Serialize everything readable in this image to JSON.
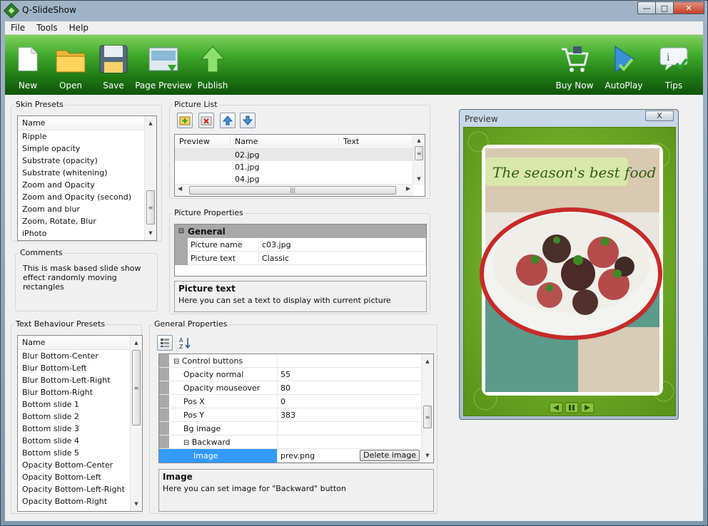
{
  "window": {
    "title": "Q-SlideShow"
  },
  "menu": [
    "File",
    "Tools",
    "Help"
  ],
  "toolbar": {
    "new": "New",
    "open": "Open",
    "save": "Save",
    "page_preview": "Page Preview",
    "publish": "Publish",
    "buy_now": "Buy Now",
    "autoplay": "AutoPlay",
    "tips": "Tips"
  },
  "skin_presets": {
    "title": "Skin Presets",
    "header": "Name",
    "items": [
      "Ripple",
      "Simple opacity",
      "Substrate (opacity)",
      "Substrate (whitening)",
      "Zoom and Opacity",
      "Zoom and Opacity (second)",
      "Zoom and blur",
      "Zoom, Rotate, Blur",
      "iPhoto"
    ]
  },
  "comments": {
    "title": "Comments",
    "text": "This is mask based slide show effect randomly moving rectangles"
  },
  "picture_list": {
    "title": "Picture List",
    "columns": [
      "Preview",
      "Name",
      "Text"
    ],
    "rows": [
      "02.jpg",
      "01.jpg",
      "04.jpg"
    ]
  },
  "picture_properties": {
    "title": "Picture Properties",
    "category": "General",
    "rows": [
      {
        "name": "Picture name",
        "value": "c03.jpg"
      },
      {
        "name": "Picture text",
        "value": "Classic"
      }
    ],
    "desc_title": "Picture text",
    "desc_text": "Here you can set a text to display with current picture"
  },
  "text_behaviour": {
    "title": "Text Behaviour Presets",
    "header": "Name",
    "items": [
      "Blur Bottom-Center",
      "Blur Bottom-Left",
      "Blur Bottom-Left-Right",
      "Blur Bottom-Right",
      "Bottom slide 1",
      "Bottom slide 2",
      "Bottom slide 3",
      "Bottom slide 4",
      "Bottom slide 5",
      "Opacity Bottom-Center",
      "Opacity Bottom-Left",
      "Opacity Bottom-Left-Right",
      "Opacity Bottom-Right"
    ]
  },
  "general_properties": {
    "title": "General Properties",
    "group": "Control buttons",
    "rows": [
      {
        "name": "Opacity normal",
        "value": "55"
      },
      {
        "name": "Opacity mouseover",
        "value": "80"
      },
      {
        "name": "Pos X",
        "value": "0"
      },
      {
        "name": "Pos Y",
        "value": "383"
      },
      {
        "name": "Bg image",
        "value": ""
      }
    ],
    "subgroup": "Backward",
    "selected": {
      "name": "Image",
      "value": "prev.png"
    },
    "delete_label": "Delete image",
    "desc_title": "Image",
    "desc_text": "Here you can set image for \"Backward\" button"
  },
  "preview": {
    "title": "Preview",
    "close": "X",
    "caption": "The season's best food"
  },
  "colors": {
    "toolbar_green": "#1f7a14",
    "accent": "#6da51e",
    "selection": "#3399ff"
  }
}
